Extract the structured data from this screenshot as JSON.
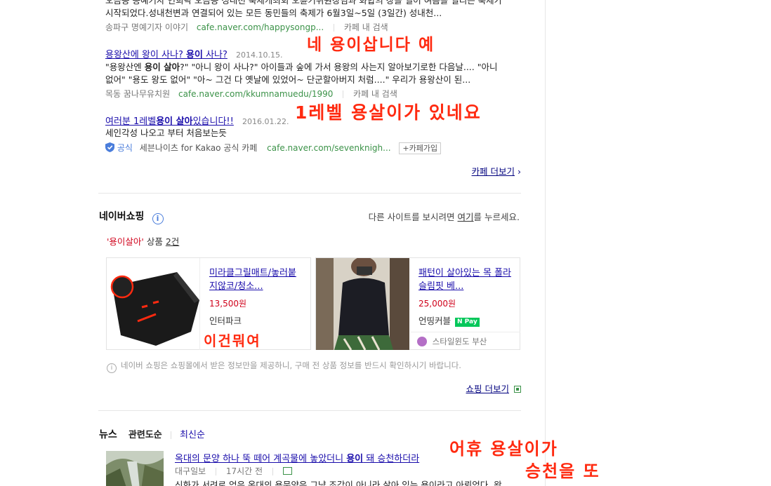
{
  "cafe": {
    "top_snippet_line1": "오금동 송예기자 연희락 오금등 성내천 축제개최회 오륜기위원장님과 화합의 장을 열어 여름을 열리는 축제가",
    "top_snippet_line2": "시작되었다.성내천변과 연결되어 있는 모든 동민들의 축제가 6월3일~5일 (3일간) 성내천...",
    "top_source": "송파구 명예기자 이야기",
    "top_url": "cafe.naver.com/happysongp...",
    "top_search": "카페 내 검색",
    "r2": {
      "title_a": "용왕산에 왕이 사나? ",
      "title_hl": "용이",
      "title_b": " 사나?",
      "date": "2014.10.15.",
      "line1_a": "\"용왕산엔 ",
      "line1_hl": "용이 살아",
      "line1_b": "?\" \"아니 왕이 사나?\" 아이들과 숲에 가서 용왕의 사는지 알아보기로한 다음날.... \"아니",
      "line2": "없어\" \"용도 왕도 없어\" \"아~ 그건 다 옛날에 있었어~ 단군할아버지 처럼....\" 우리가 용왕산이 된...",
      "source": "목동 꿈나무유치원",
      "url": "cafe.naver.com/kkumnamuedu/1990",
      "search": "카페 내 검색"
    },
    "r3": {
      "title_a": "여러분 1레벨",
      "title_hl": "용이 살아",
      "title_b": "있습니다!!",
      "date": "2016.01.22.",
      "line1": "세인각성 나오고 부터 처음보는듯",
      "official": "공식",
      "source": "세븐나이츠 for Kakao 공식 카페",
      "url": "cafe.naver.com/sevenknigh...",
      "join": "+카페가입"
    },
    "more": "카페 더보기"
  },
  "shopping": {
    "title": "네이버쇼핑",
    "other_a": "다른 사이트를 보시려면 ",
    "other_link": "여기",
    "other_b": "를 누르세요.",
    "query": "'용이살아'",
    "count_label": " 상품 ",
    "count": "2건",
    "products": [
      {
        "title": "미라클그릴매트/놓러붙지않코/청소...",
        "price": "13,500원",
        "seller": "인터파크"
      },
      {
        "title": "패턴이 살아있는 목 폴라 슬림핏 베...",
        "price": "25,000원",
        "seller": "언띵커블",
        "npay": "N Pay",
        "sub_seller": "스타일윈도 부산"
      }
    ],
    "notice": "네이버 쇼핑은 쇼핑몰에서 받은 정보만을 제공하니, 구매 전 상품 정보를 반드시 확인하시기 바랍니다.",
    "more": "쇼핑 더보기"
  },
  "news": {
    "title": "뉴스",
    "sort_relevance": "관련도순",
    "sort_latest": "최신순",
    "item": {
      "title_a": "옥대의 문양 하나 뚝 떼어 계곡물에 놓았더니 ",
      "title_hl": "용이",
      "title_b": " 돼 승천하더라",
      "source": "대구일보",
      "time": "17시간 전",
      "snippet": "신화가 서려로 얻은 옥대의 용문양은 그냥 조각이 아니라 살아 있는 용이라고 아뢰었다. 왕"
    }
  },
  "annotations": {
    "a1": "네 용이삽니다 예",
    "a2": "1레벨 용살이가 있네요",
    "a3": "이건뭐여",
    "a4_line1": "어휴 용살이가",
    "a4_line2": "승천을 또"
  },
  "colors": {
    "hand": "#ff2a10",
    "link": "#1a0dab",
    "url": "#3b9248",
    "price": "#d0021b",
    "npay": "#03c75a"
  }
}
